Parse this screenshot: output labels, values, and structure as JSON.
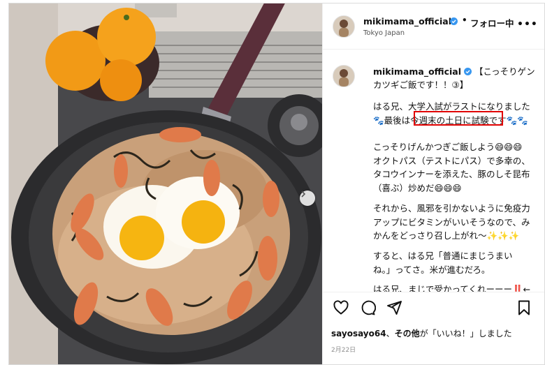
{
  "header": {
    "username": "mikimama_official",
    "separator": "•",
    "follow_label": "フォロー中",
    "location": "Tokyo Japan",
    "more_label": "•••"
  },
  "caption": {
    "username": "mikimama_official",
    "headline": "【こっそりゲンカツギご飯です！！③】",
    "paragraphs": [
      "はる兄、大学入試がラストになりました\n🐾最後は今週末の土日に試験です🐾🐾",
      "こっそりげんかつぎご飯しよう😄😄😄\nオクトパス（テストにパス）で多幸の、\nタコウインナーを添えた、豚のしそ昆布\n（喜ぶ）炒めだ😄😄😄",
      "それから、風邪を引かないように免疫力\nアップにビタミンがいいそうなので、み\nかんをどっさり召し上がれ〜✨✨✨",
      "すると、はる兄「普通にまじうまい\nね。」ってさ。米が進むだろ。",
      "はる兄、まじで受かってくれーーー‼️←"
    ],
    "highlight_text": "今週末の土日に試験"
  },
  "actions": {
    "like_icon": "heart-icon",
    "comment_icon": "comment-icon",
    "share_icon": "paper-plane-icon",
    "save_icon": "bookmark-icon"
  },
  "likes": {
    "user": "sayosayo64",
    "connector": "、",
    "others": "その他",
    "suffix": "が「いいね！」しました"
  },
  "date": "2月22日",
  "colors": {
    "verified": "#3897f0",
    "highlight": "#e00000",
    "pan": "#3a3a3c",
    "handle": "#5a2f3a"
  }
}
